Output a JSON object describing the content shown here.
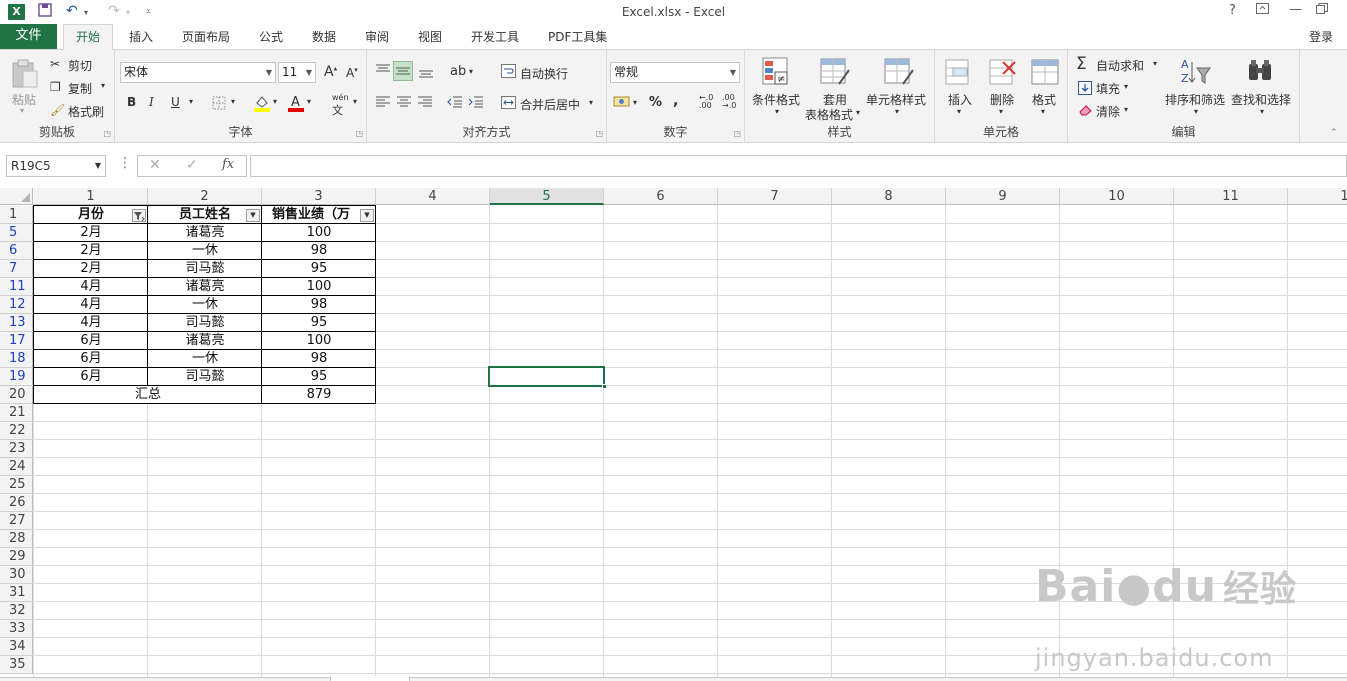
{
  "window": {
    "title": "Excel.xlsx - Excel",
    "app_icon": "X",
    "help": "?",
    "login": "登录"
  },
  "tabs": [
    "文件",
    "开始",
    "插入",
    "页面布局",
    "公式",
    "数据",
    "审阅",
    "视图",
    "开发工具",
    "PDF工具集"
  ],
  "ribbon": {
    "clipboard": {
      "paste": "粘贴",
      "cut": "剪切",
      "copy": "复制",
      "format_painter": "格式刷",
      "label": "剪贴板"
    },
    "font": {
      "name": "宋体",
      "size": "11",
      "bold": "B",
      "italic": "I",
      "underline": "U",
      "wen": "wén",
      "label": "字体"
    },
    "alignment": {
      "wrap": "自动换行",
      "merge": "合并后居中",
      "label": "对齐方式"
    },
    "number": {
      "format": "常规",
      "percent": "%",
      "comma": ",",
      "label": "数字"
    },
    "styles": {
      "conditional": "条件格式",
      "table_1": "套用",
      "table_2": "表格格式",
      "cell_styles": "单元格样式",
      "label": "样式"
    },
    "cells": {
      "insert": "插入",
      "delete": "删除",
      "format": "格式",
      "label": "单元格"
    },
    "editing": {
      "autosum": "自动求和",
      "fill": "填充",
      "clear": "清除",
      "sort": "排序和筛选",
      "find": "查找和选择",
      "label": "编辑"
    }
  },
  "formula_bar": {
    "name_box": "R19C5",
    "fx": "fx",
    "value": ""
  },
  "sheet": {
    "columns": [
      "1",
      "2",
      "3",
      "4",
      "5",
      "6",
      "7",
      "8",
      "9",
      "10",
      "11",
      "1"
    ],
    "selected_column": "5",
    "headers": [
      "月份",
      "员工姓名",
      "销售业绩（万"
    ],
    "rows": [
      {
        "n": "1",
        "header": true
      },
      {
        "n": "5",
        "c": [
          "2月",
          "诸葛亮",
          "100"
        ],
        "filtered": true
      },
      {
        "n": "6",
        "c": [
          "2月",
          "一休",
          "98"
        ],
        "filtered": true
      },
      {
        "n": "7",
        "c": [
          "2月",
          "司马懿",
          "95"
        ],
        "filtered": true
      },
      {
        "n": "11",
        "c": [
          "4月",
          "诸葛亮",
          "100"
        ],
        "filtered": true
      },
      {
        "n": "12",
        "c": [
          "4月",
          "一休",
          "98"
        ],
        "filtered": true
      },
      {
        "n": "13",
        "c": [
          "4月",
          "司马懿",
          "95"
        ],
        "filtered": true
      },
      {
        "n": "17",
        "c": [
          "6月",
          "诸葛亮",
          "100"
        ],
        "filtered": true
      },
      {
        "n": "18",
        "c": [
          "6月",
          "一休",
          "98"
        ],
        "filtered": true
      },
      {
        "n": "19",
        "c": [
          "6月",
          "司马懿",
          "95"
        ],
        "filtered": true
      },
      {
        "n": "20",
        "total": true,
        "c": [
          "汇总",
          "879"
        ]
      },
      {
        "n": "21"
      },
      {
        "n": "22"
      },
      {
        "n": "23"
      },
      {
        "n": "24"
      },
      {
        "n": "25"
      },
      {
        "n": "26"
      },
      {
        "n": "27"
      },
      {
        "n": "28"
      },
      {
        "n": "29"
      },
      {
        "n": "30"
      },
      {
        "n": "31"
      },
      {
        "n": "32"
      },
      {
        "n": "33"
      },
      {
        "n": "34"
      },
      {
        "n": "35"
      }
    ]
  },
  "watermark": {
    "brand": "Bai",
    "brand2": "du",
    "cn": "经验",
    "url": "jingyan.baidu.com"
  },
  "colors": {
    "accent": "#217346",
    "filter_row": "#1f3fbf"
  }
}
